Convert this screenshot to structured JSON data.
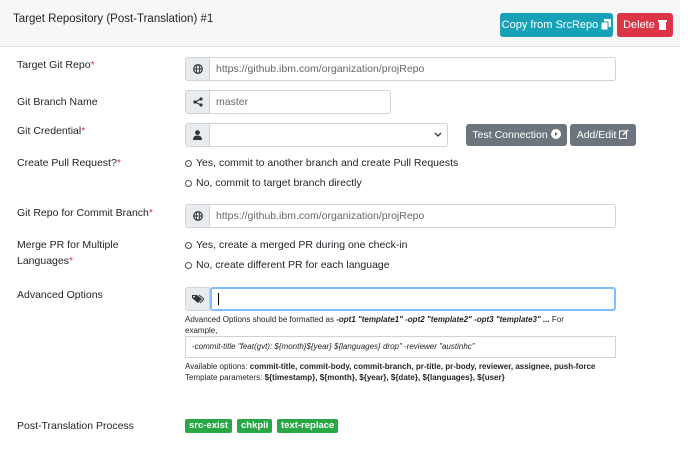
{
  "header": {
    "title": "Target Repository (Post-Translation) #1",
    "copy_label": "Copy from SrcRepo",
    "delete_label": "Delete"
  },
  "fields": {
    "target_repo_label": "Target Git Repo",
    "target_repo_value": "https://github.ibm.com/organization/projRepo",
    "branch_label": "Git Branch Name",
    "branch_value": "master",
    "credential_label": "Git Credential",
    "credential_value": "",
    "test_connection_label": "Test Connection",
    "add_edit_label": "Add/Edit",
    "pr_label": "Create Pull Request?",
    "pr_yes": "Yes, commit to another branch and create Pull Requests",
    "pr_no": "No, commit to target branch directly",
    "commit_repo_label": "Git Repo for Commit Branch",
    "commit_repo_value": "https://github.ibm.com/organization/projRepo",
    "merge_label_1": "Merge PR for Multiple",
    "merge_label_2": "Languages",
    "merge_yes": "Yes, create a merged PR during one check-in",
    "merge_no": "No, create different PR for each language",
    "adv_label": "Advanced Options",
    "adv_value": "",
    "adv_help_1a": "Advanced Options should be formatted as ",
    "adv_help_1b": "-opt1 \"template1\" -opt2 \"template2\" -opt3 \"template3\" ...",
    "adv_help_1c": " For",
    "adv_help_2": "example,",
    "adv_example": "-commit-title \"feat(gvt): ${month}${year} ${languages} drop\" -reviewer \"austinhc\"",
    "avail_prefix": "Available options: ",
    "avail_options": "commit-title, commit-body, commit-branch, pr-title, pr-body, reviewer, assignee, push-force",
    "tmpl_prefix": "Template parameters: ",
    "tmpl_params": "${timestamp}, ${month}, ${year}, ${date}, ${languages}, ${user}",
    "post_label": "Post-Translation Process",
    "tags": [
      "src-exist",
      "chkpii",
      "text-replace"
    ]
  },
  "colors": {
    "info": "#17a2b8",
    "danger": "#dc3545",
    "secondary": "#6c757d",
    "success": "#28a745"
  },
  "icons": [
    "copy-icon",
    "trash-icon",
    "globe-icon",
    "share-icon",
    "user-icon",
    "chevron-down-icon",
    "play-circle-icon",
    "edit-icon",
    "tags-icon"
  ]
}
